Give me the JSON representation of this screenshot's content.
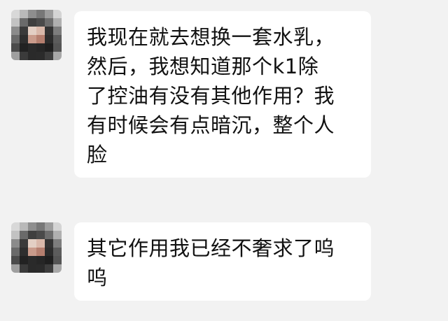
{
  "messages": [
    {
      "lines": [
        "我现在就去想换一套水乳，",
        "然后，我想知道那个k1除",
        "了控油有没有其他作用？我",
        "有时候会有点暗沉，整个人",
        "脸"
      ]
    },
    {
      "lines": [
        "其它作用我已经不奢求了呜",
        "呜"
      ]
    }
  ],
  "colors": {
    "background": "#f2f2f2",
    "bubble": "#ffffff",
    "text": "#111111"
  },
  "avatar_mosaic": [
    "#d8d8d8",
    "#b9b9b9",
    "#8e8e8e",
    "#777777",
    "#9d9d9d",
    "#d4d4d4",
    "#c2c2c2",
    "#6a6a6a",
    "#3f3f3f",
    "#4a4a4a",
    "#6d6d6d",
    "#b0b0b0",
    "#8b8b8b",
    "#3a3a3a",
    "#e3cfc4",
    "#d9b8aa",
    "#333333",
    "#7d7d7d",
    "#6a6a6a",
    "#2e2e2e",
    "#c99b8b",
    "#b57f6f",
    "#2c2c2c",
    "#5c5c5c",
    "#4b4b4b",
    "#222222",
    "#2a2a2a",
    "#262626",
    "#1f1f1f",
    "#555555",
    "#9f9f9f",
    "#3b3b3b",
    "#2a2a2a",
    "#2b2b2b",
    "#3d3d3d",
    "#a8a8a8"
  ]
}
